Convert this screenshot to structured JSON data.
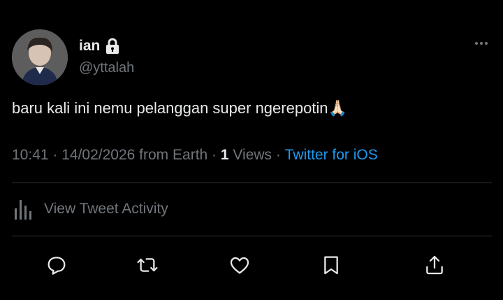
{
  "user": {
    "display_name": "ian",
    "handle": "@yttalah",
    "avatar": "avatar-photo",
    "lock_icon": "lock-icon"
  },
  "tweet": {
    "text": "baru kali ini nemu pelanggan super ngerepotin",
    "emoji": "🙏🏻"
  },
  "meta": {
    "time": "10:41",
    "sep1": " · ",
    "date": "14/02/2026",
    "location": " from Earth",
    "sep2": " · ",
    "views_count": "1",
    "views_label": " Views",
    "sep3": " · ",
    "source": "Twitter for iOS"
  },
  "activity": {
    "label": "View Tweet Activity",
    "icon": "bar-chart-icon"
  },
  "actions": [
    "reply-icon",
    "retweet-icon",
    "like-icon",
    "bookmark-icon",
    "share-icon"
  ],
  "colors": {
    "background": "#000000",
    "text_primary": "#e7e9ea",
    "text_secondary": "#71767b",
    "link": "#1d9bf0",
    "divider": "#2f3336"
  }
}
